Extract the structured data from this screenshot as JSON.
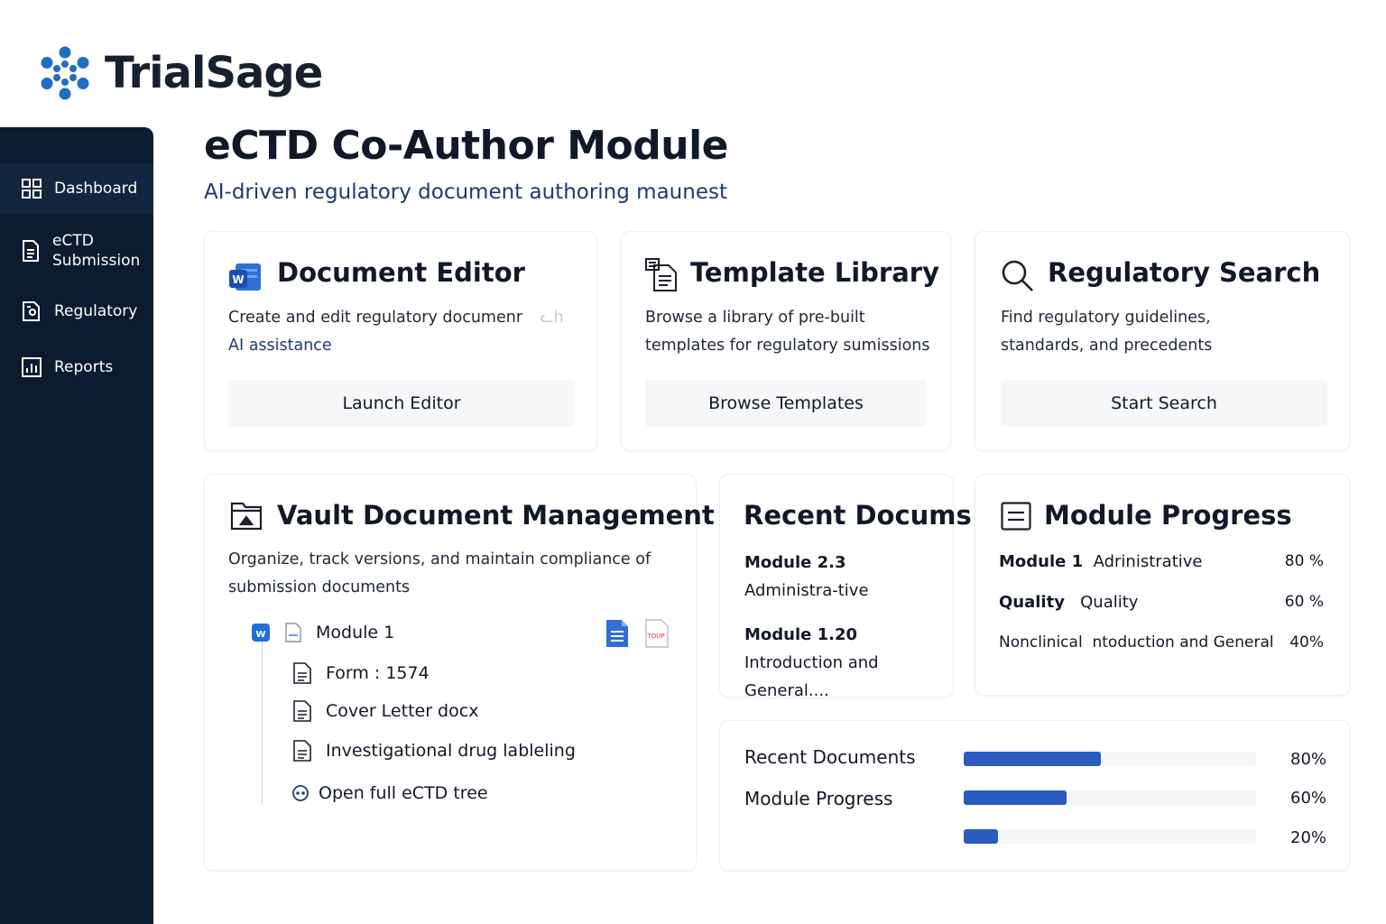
{
  "brand": {
    "name": "TrialSage",
    "accent": "#1f6fc1"
  },
  "sidebar": {
    "background": "#0b1b30",
    "items": [
      {
        "label": "Dashboard",
        "icon": "grid-icon",
        "active": true
      },
      {
        "label": "eCTD\nSubmission",
        "icon": "document-icon",
        "active": false
      },
      {
        "label": "Regulatory",
        "icon": "regulatory-icon",
        "active": false
      },
      {
        "label": "Reports",
        "icon": "bar-chart-icon",
        "active": false
      }
    ]
  },
  "page": {
    "title": "eCTD Co-Author Module",
    "subtitle": "AI-driven regulatory document authoring maunest"
  },
  "cards": {
    "document_editor": {
      "title": "Document Editor",
      "description_line1": "Create and edit regulatory documenr",
      "description_trailing": "ᓚh",
      "description_line2": "AI assistance",
      "button": "Launch Editor",
      "icon": "word-icon"
    },
    "template_library": {
      "title": "Template Library",
      "description": "Browse a library of pre-built templates for regulatory sumissions",
      "button": "Browse Templates",
      "icon": "template-icon"
    },
    "regulatory_search": {
      "title": "Regulatory Search",
      "description": "Find regulatory guidelines, standards, and precedents",
      "button": "Start Search",
      "icon": "search-icon"
    },
    "vault": {
      "title": "Vault Document Management",
      "description": "Organize, track versions, and maintain compliance of submission documents",
      "tree": {
        "root": "Module 1",
        "children": [
          "Form : 1574",
          "Cover Letter  docx",
          "Investigational  drug lableling"
        ],
        "open_link": "Open full eCTD tree",
        "pdf_badge": "TOUP"
      }
    },
    "recent_docs": {
      "title": "Recent Docums",
      "items": [
        {
          "bold": "Module 2.3",
          "rest": " Administra-tive"
        },
        {
          "bold": "Module 1.20",
          "rest": " Introduction and General...."
        }
      ]
    },
    "module_progress": {
      "title": "Module Progress",
      "rows": [
        {
          "bold": "Module 1",
          "label": "  Adrinistrative",
          "percent": "80 %"
        },
        {
          "bold": "Quality",
          "label": "   Quality",
          "percent": "60 %"
        },
        {
          "bold": "",
          "label": "Nonclinical  ntoduction and General",
          "percent": "40%"
        }
      ]
    },
    "progress_summary": {
      "labels": [
        "Recent Documents",
        "Module Progress"
      ],
      "bars": [
        {
          "value": 0.8,
          "percent": "80%"
        },
        {
          "value": 0.6,
          "percent": "60%"
        },
        {
          "value": 0.2,
          "percent": "20%"
        }
      ],
      "bar_color": "#2a5cbf"
    }
  }
}
